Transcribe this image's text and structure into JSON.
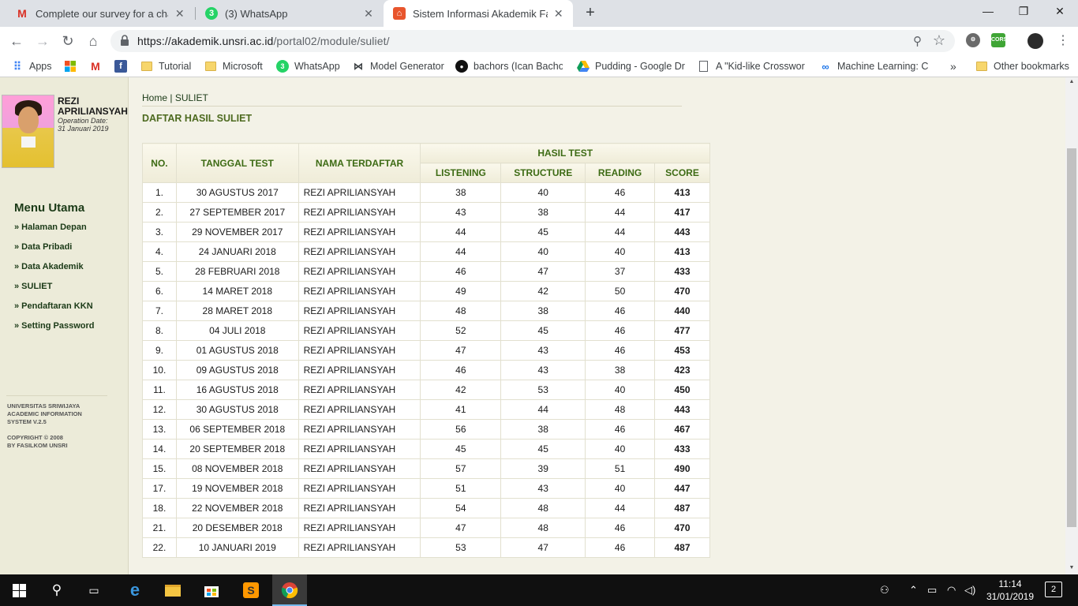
{
  "browser": {
    "tabs": [
      {
        "title": "Complete our survey for a chanc",
        "icon": "gmail-icon"
      },
      {
        "title": "(3) WhatsApp",
        "icon": "whatsapp-icon",
        "badge": "3"
      },
      {
        "title": "Sistem Informasi Akademik Fakul",
        "icon": "unsri-icon"
      }
    ],
    "url_host": "https://akademik.unsri.ac.id",
    "url_path": "/portal02/module/suliet/",
    "bookmarks": [
      {
        "label": "Apps",
        "icon": "apps-grid-icon"
      },
      {
        "label": "",
        "icon": "windows-logo-icon"
      },
      {
        "label": "",
        "icon": "gmail-icon"
      },
      {
        "label": "",
        "icon": "facebook-icon"
      },
      {
        "label": "Tutorial",
        "icon": "folder-icon"
      },
      {
        "label": "Microsoft",
        "icon": "folder-icon"
      },
      {
        "label": "WhatsApp",
        "icon": "whatsapp-icon"
      },
      {
        "label": "Model Generator",
        "icon": "bowtie-icon"
      },
      {
        "label": "bachors (Ican Bachor",
        "icon": "github-icon"
      },
      {
        "label": "Pudding - Google Dr",
        "icon": "google-drive-icon"
      },
      {
        "label": "A \"Kid-like Crosswor",
        "icon": "document-icon"
      },
      {
        "label": "Machine Learning: Cl",
        "icon": "link-icon"
      }
    ],
    "more_bookmarks": "»",
    "other_bookmarks": "Other bookmarks"
  },
  "user": {
    "name_line1": "REZI",
    "name_line2": "APRILIANSYAH",
    "op_label": "Operation Date:",
    "op_date": "31 Januari 2019"
  },
  "menu": {
    "title": "Menu Utama",
    "items": [
      "» Halaman Depan",
      "» Data Pribadi",
      "» Data Akademik",
      "» SULIET",
      "» Pendaftaran KKN",
      "» Setting Password"
    ]
  },
  "footer": {
    "line1": "UNIVERSITAS SRIWIJAYA",
    "line2": "ACADEMIC INFORMATION",
    "line3": "SYSTEM V.2.5",
    "line4": "COPYRIGHT © 2008",
    "line5": "BY FASILKOM UNSRI"
  },
  "breadcrumb": {
    "home": "Home",
    "sep": "|",
    "current": "SULIET"
  },
  "page_title": "DAFTAR HASIL SULIET",
  "table": {
    "headers": {
      "no": "NO.",
      "date": "TANGGAL TEST",
      "name": "NAMA TERDAFTAR",
      "group": "HASIL TEST",
      "listening": "LISTENING",
      "structure": "STRUCTURE",
      "reading": "READING",
      "score": "SCORE"
    },
    "rows": [
      [
        "1.",
        "30 AGUSTUS 2017",
        "REZI APRILIANSYAH",
        "38",
        "40",
        "46",
        "413"
      ],
      [
        "2.",
        "27 SEPTEMBER 2017",
        "REZI APRILIANSYAH",
        "43",
        "38",
        "44",
        "417"
      ],
      [
        "3.",
        "29 NOVEMBER 2017",
        "REZI APRILIANSYAH",
        "44",
        "45",
        "44",
        "443"
      ],
      [
        "4.",
        "24 JANUARI 2018",
        "REZI APRILIANSYAH",
        "44",
        "40",
        "40",
        "413"
      ],
      [
        "5.",
        "28 FEBRUARI 2018",
        "REZI APRILIANSYAH",
        "46",
        "47",
        "37",
        "433"
      ],
      [
        "6.",
        "14 MARET 2018",
        "REZI APRILIANSYAH",
        "49",
        "42",
        "50",
        "470"
      ],
      [
        "7.",
        "28 MARET 2018",
        "REZI APRILIANSYAH",
        "48",
        "38",
        "46",
        "440"
      ],
      [
        "8.",
        "04 JULI 2018",
        "REZI APRILIANSYAH",
        "52",
        "45",
        "46",
        "477"
      ],
      [
        "9.",
        "01 AGUSTUS 2018",
        "REZI APRILIANSYAH",
        "47",
        "43",
        "46",
        "453"
      ],
      [
        "10.",
        "09 AGUSTUS 2018",
        "REZI APRILIANSYAH",
        "46",
        "43",
        "38",
        "423"
      ],
      [
        "11.",
        "16 AGUSTUS 2018",
        "REZI APRILIANSYAH",
        "42",
        "53",
        "40",
        "450"
      ],
      [
        "12.",
        "30 AGUSTUS 2018",
        "REZI APRILIANSYAH",
        "41",
        "44",
        "48",
        "443"
      ],
      [
        "13.",
        "06 SEPTEMBER 2018",
        "REZI APRILIANSYAH",
        "56",
        "38",
        "46",
        "467"
      ],
      [
        "14.",
        "20 SEPTEMBER 2018",
        "REZI APRILIANSYAH",
        "45",
        "45",
        "40",
        "433"
      ],
      [
        "15.",
        "08 NOVEMBER 2018",
        "REZI APRILIANSYAH",
        "57",
        "39",
        "51",
        "490"
      ],
      [
        "17.",
        "19 NOVEMBER 2018",
        "REZI APRILIANSYAH",
        "51",
        "43",
        "40",
        "447"
      ],
      [
        "18.",
        "22 NOVEMBER 2018",
        "REZI APRILIANSYAH",
        "54",
        "48",
        "44",
        "487"
      ],
      [
        "21.",
        "20 DESEMBER 2018",
        "REZI APRILIANSYAH",
        "47",
        "48",
        "46",
        "470"
      ],
      [
        "22.",
        "10 JANUARI 2019",
        "REZI APRILIANSYAH",
        "53",
        "47",
        "46",
        "487"
      ]
    ]
  },
  "taskbar": {
    "time": "11:14",
    "date": "31/01/2019",
    "notifications": "2"
  },
  "colors": {
    "accent_green": "#3d6b14",
    "sidebar_bg": "#ecebd9",
    "page_bg": "#f3f2e7"
  }
}
